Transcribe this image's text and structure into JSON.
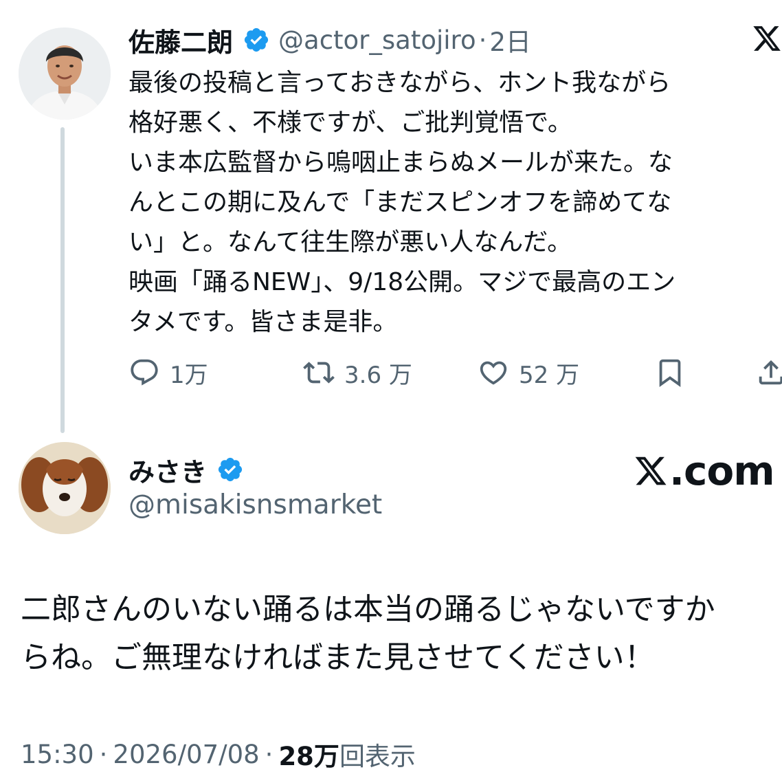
{
  "colors": {
    "verified_blue": "#1d9bf0",
    "text_primary": "#0f1419",
    "text_secondary": "#536471",
    "thread_line": "#cfd9de"
  },
  "tweet": {
    "author_name": "佐藤二朗",
    "handle": "@actor_satojiro",
    "separator": "·",
    "time": "2日",
    "text": "最後の投稿と言っておきながら、ホント我ながら\n格好悪く、不様ですが、ご批判覚悟で。\nいま本広監督から嗚咽止まらぬメールが来た。な\nんとこの期に及んで「まだスピンオフを諦めてな\nい」と。なんて往生際が悪い人なんだ。\n映画「踊るNEW」、9/18公開。マジで最高のエン\nタメです。皆さま是非。",
    "actions": {
      "replies": "1万",
      "reposts": "3.6 万",
      "likes": "52 万"
    },
    "icons": [
      "verified-badge-icon",
      "x-logo-icon",
      "reply-icon",
      "repost-icon",
      "like-icon",
      "bookmark-icon",
      "share-icon"
    ]
  },
  "reply": {
    "author_name": "みさき",
    "handle": "@misakisnsmarket",
    "brand": ".com",
    "text": "二郎さんのいない踊るは本当の踊るじゃないですか\nらね。ご無理なければまた見させてください！"
  },
  "footer": {
    "time": "15:30",
    "sep1": "·",
    "date": "2026/07/08",
    "sep2": "·",
    "views_count": "28万",
    "views_label": "回表示"
  }
}
